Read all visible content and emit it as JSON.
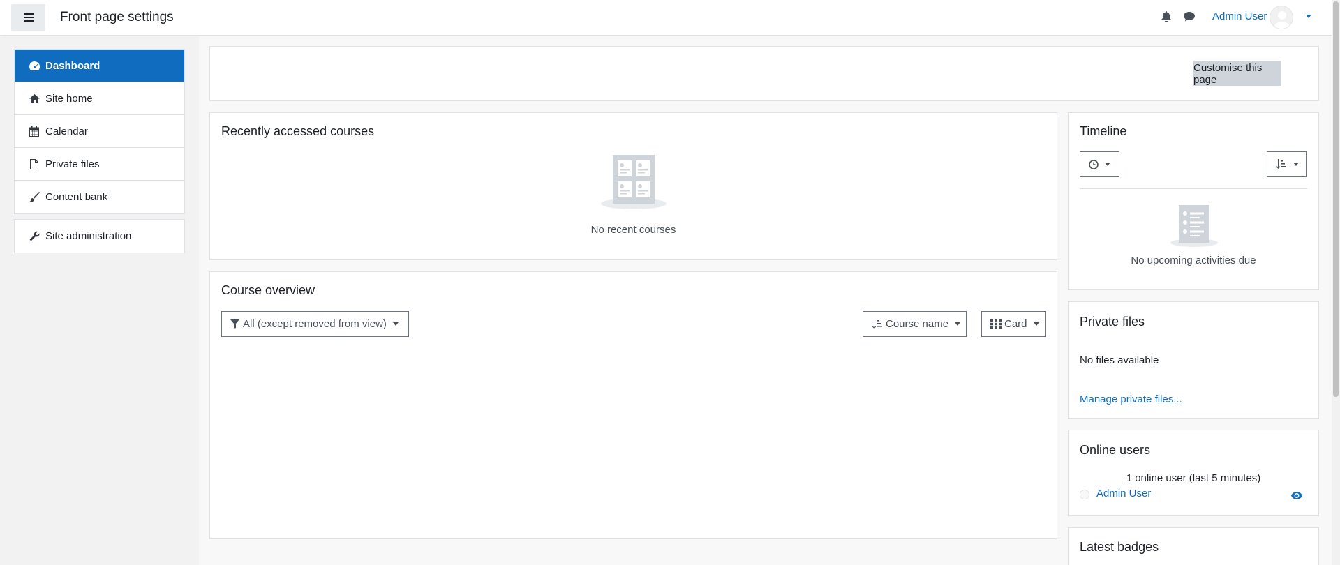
{
  "header": {
    "menu_icon": "hamburger-icon",
    "title": "Front page settings",
    "user_name": "Admin User",
    "icons": [
      "bell-icon",
      "chat-icon",
      "avatar",
      "chevron-down-icon"
    ]
  },
  "sidebar": {
    "items": [
      {
        "label": "Dashboard",
        "icon": "dashboard-icon",
        "active": true
      },
      {
        "label": "Site home",
        "icon": "home-icon"
      },
      {
        "label": "Calendar",
        "icon": "calendar-icon"
      },
      {
        "label": "Private files",
        "icon": "file-icon"
      },
      {
        "label": "Content bank",
        "icon": "brush-icon"
      }
    ],
    "admin": {
      "label": "Site administration",
      "icon": "wrench-icon"
    }
  },
  "toolbar": {
    "customise_label": "Customise this page"
  },
  "recent": {
    "title": "Recently accessed courses",
    "empty_text": "No recent courses"
  },
  "overview": {
    "title": "Course overview",
    "filter_label": "All (except removed from view)",
    "sort_label": "Course name",
    "view_label": "Card"
  },
  "timeline": {
    "title": "Timeline",
    "empty_text": "No upcoming activities due"
  },
  "private_files": {
    "title": "Private files",
    "empty_text": "No files available",
    "manage_link": "Manage private files..."
  },
  "online_users": {
    "title": "Online users",
    "summary": "1 online user (last 5 minutes)",
    "user": "Admin User"
  },
  "badges": {
    "title": "Latest badges"
  },
  "colors": {
    "accent": "#0f6cbf",
    "page_bg": "#f2f2f2",
    "button_bg": "#ced4da"
  }
}
